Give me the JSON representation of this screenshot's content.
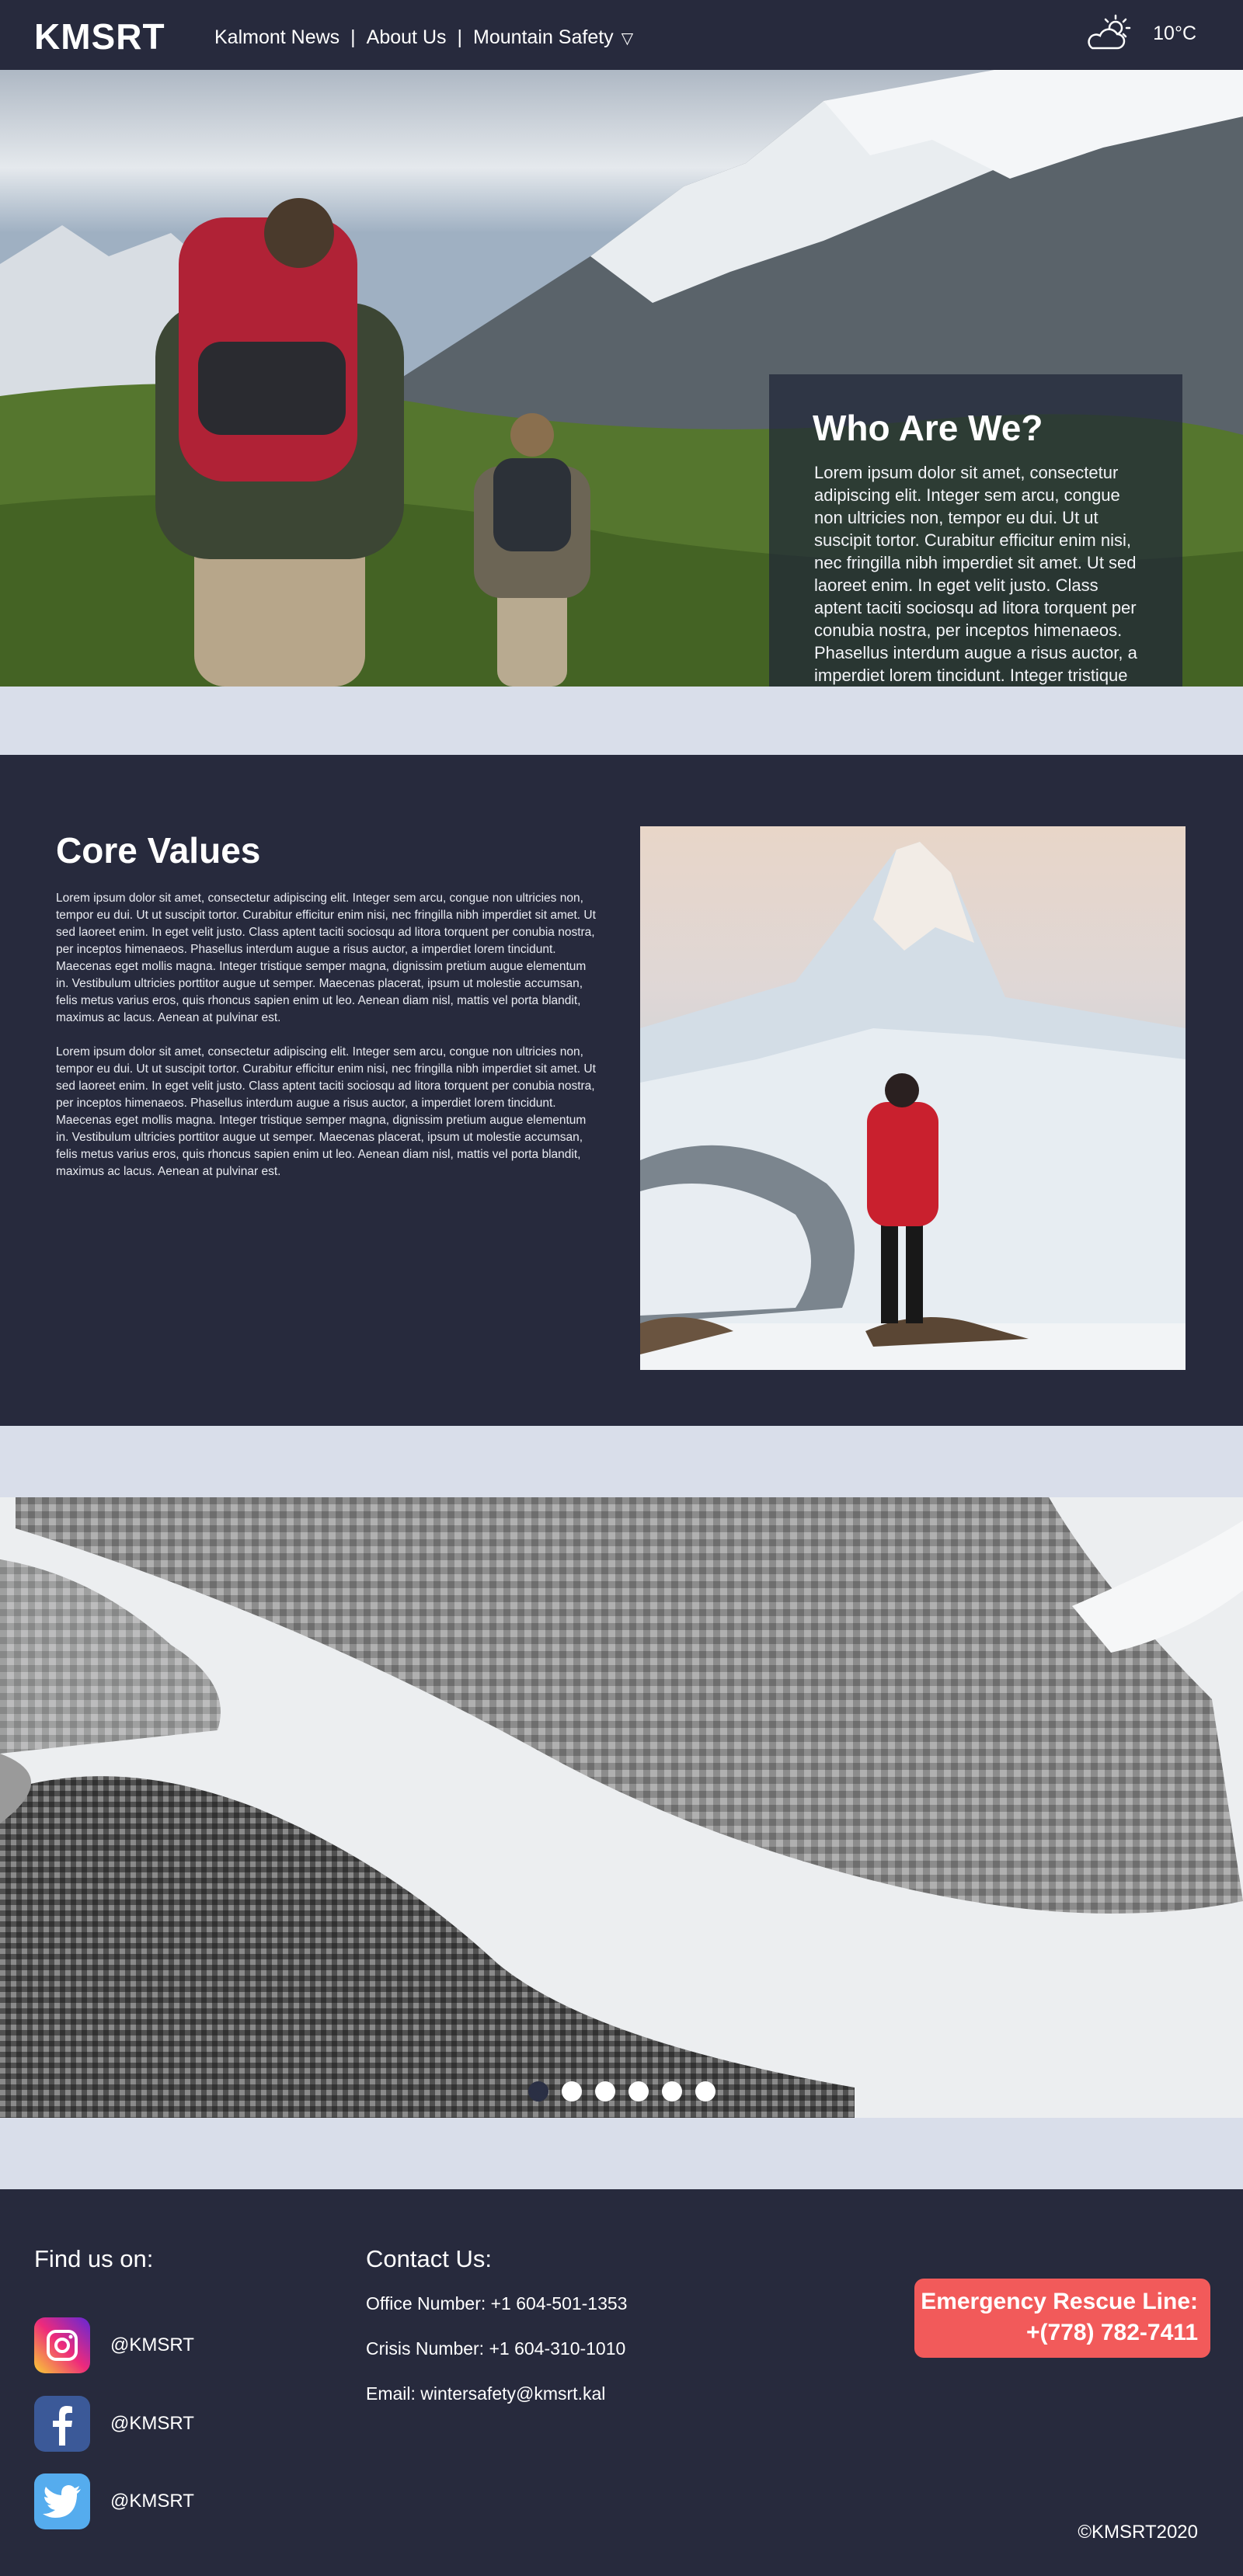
{
  "nav": {
    "logo": "KMSRT",
    "links": [
      "Kalmont News",
      "About Us",
      "Mountain Safety"
    ],
    "separator": "|",
    "dropdown_caret": "▽",
    "weather_icon": "partly-cloudy-icon",
    "temperature": "10°C"
  },
  "hero": {
    "title": "Who Are We?",
    "body": "Lorem ipsum dolor sit amet, consectetur adipiscing elit. Integer sem arcu, congue non ultricies non, tempor eu dui. Ut ut suscipit tortor. Curabitur efficitur enim nisi, nec fringilla nibh imperdiet sit amet. Ut sed laoreet enim. In eget velit justo. Class aptent taciti sociosqu ad litora torquent per conubia nostra, per inceptos himenaeos. Phasellus interdum augue a risus auctor, a imperdiet lorem tincidunt. Integer tristique semper magna, dignissim."
  },
  "core": {
    "title": "Core Values",
    "paragraphs": [
      "Lorem ipsum dolor sit amet, consectetur adipiscing elit. Integer sem arcu, congue non ultricies non, tempor eu dui. Ut ut suscipit tortor. Curabitur efficitur enim nisi, nec fringilla nibh imperdiet sit amet. Ut sed laoreet enim. In eget velit justo. Class aptent taciti sociosqu ad litora torquent per conubia nostra, per inceptos himenaeos. Phasellus interdum augue a risus auctor, a imperdiet lorem tincidunt. Maecenas eget mollis magna. Integer tristique semper magna, dignissim pretium augue elementum in. Vestibulum ultricies porttitor augue ut semper. Maecenas placerat, ipsum ut molestie accumsan, felis metus varius eros, quis rhoncus sapien enim ut leo. Aenean diam nisl, mattis vel porta blandit, maximus ac lacus. Aenean at pulvinar est.",
      "Lorem ipsum dolor sit amet, consectetur adipiscing elit. Integer sem arcu, congue non ultricies non, tempor eu dui. Ut ut suscipit tortor. Curabitur efficitur enim nisi, nec fringilla nibh imperdiet sit amet. Ut sed laoreet enim. In eget velit justo. Class aptent taciti sociosqu ad litora torquent per conubia nostra, per inceptos himenaeos. Phasellus interdum augue a risus auctor, a imperdiet lorem tincidunt. Maecenas eget mollis magna. Integer tristique semper magna, dignissim pretium augue elementum in. Vestibulum ultricies porttitor augue ut semper. Maecenas placerat, ipsum ut molestie accumsan, felis metus varius eros, quis rhoncus sapien enim ut leo. Aenean diam nisl, mattis vel porta blandit, maximus ac lacus. Aenean at pulvinar est."
    ]
  },
  "carousel": {
    "slide_count": 6,
    "active_index": 0
  },
  "footer": {
    "find_title": "Find us on:",
    "socials": [
      {
        "icon": "instagram-icon",
        "handle": "@KMSRT"
      },
      {
        "icon": "facebook-icon",
        "handle": "@KMSRT"
      },
      {
        "icon": "twitter-icon",
        "handle": "@KMSRT"
      }
    ],
    "contact_title": "Contact Us:",
    "office": "Office Number: +1 604-501-1353",
    "crisis": "Crisis Number: +1 604-310-1010",
    "email": "Email: wintersafety@kmsrt.kal",
    "rescue_line_1": "Emergency Rescue Line:",
    "rescue_line_2": "+(778) 782-7411",
    "copyright": "©KMSRT2020"
  },
  "colors": {
    "navy": "#272a3d",
    "page_bg": "#d9deea",
    "accent_blue": "#607ba6",
    "emergency_red": "#f25a5a"
  }
}
